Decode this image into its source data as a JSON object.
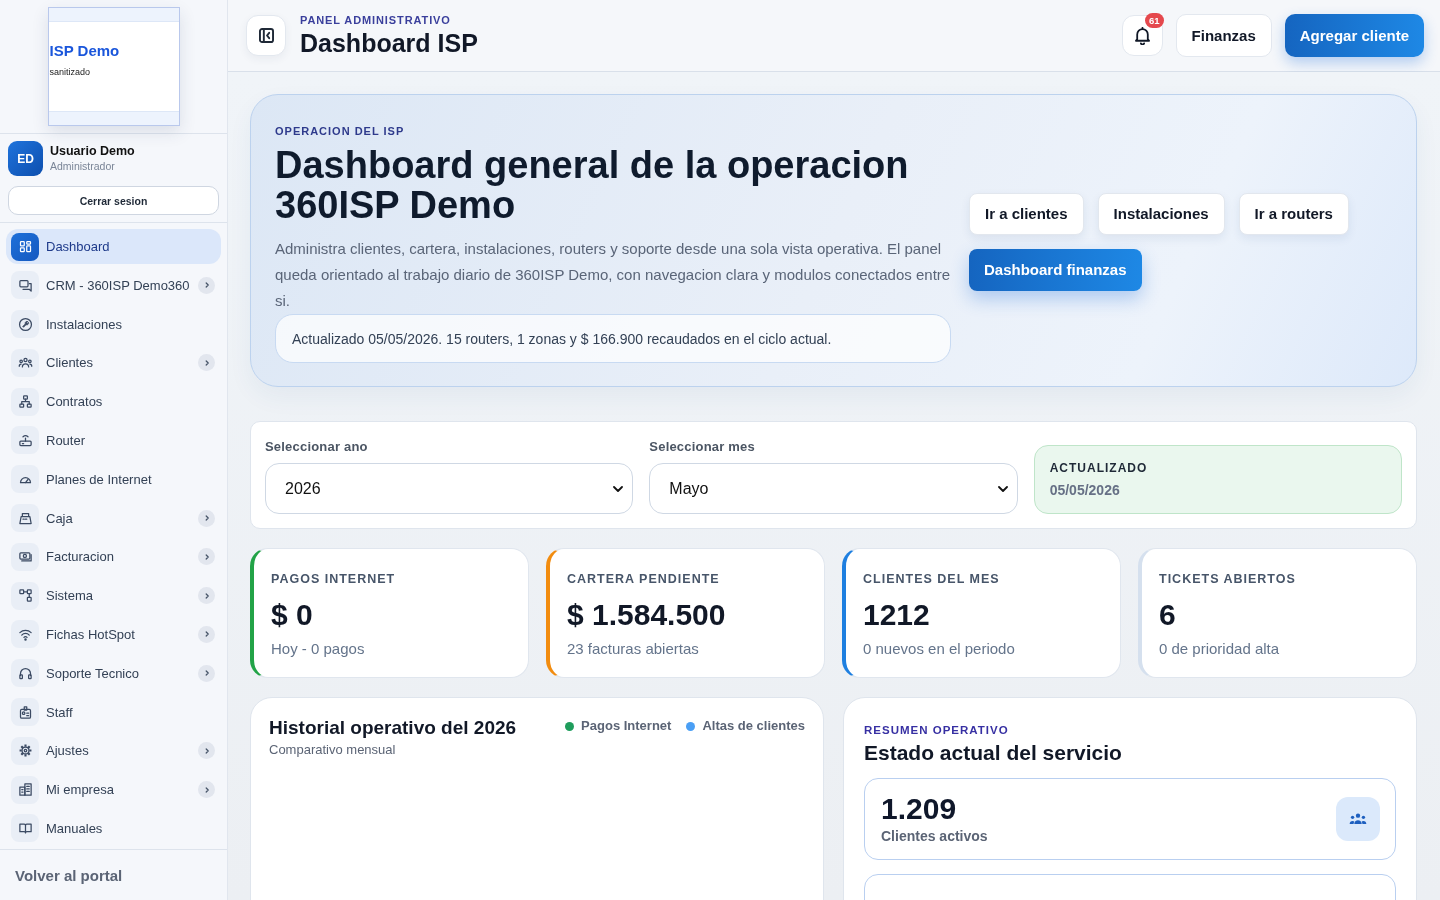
{
  "sidebar": {
    "logo": {
      "title": "ISP Demo",
      "caption": "sanitizado"
    },
    "user": {
      "initials": "ED",
      "name": "Usuario Demo",
      "role": "Administrador",
      "logout": "Cerrar sesion"
    },
    "items": [
      {
        "label": "Dashboard",
        "selected": true,
        "submenu": false
      },
      {
        "label": "CRM - 360ISP Demo360",
        "selected": false,
        "submenu": true
      },
      {
        "label": "Instalaciones",
        "selected": false,
        "submenu": false
      },
      {
        "label": "Clientes",
        "selected": false,
        "submenu": true
      },
      {
        "label": "Contratos",
        "selected": false,
        "submenu": false
      },
      {
        "label": "Router",
        "selected": false,
        "submenu": false
      },
      {
        "label": "Planes de Internet",
        "selected": false,
        "submenu": false
      },
      {
        "label": "Caja",
        "selected": false,
        "submenu": true
      },
      {
        "label": "Facturacion",
        "selected": false,
        "submenu": true
      },
      {
        "label": "Sistema",
        "selected": false,
        "submenu": true
      },
      {
        "label": "Fichas HotSpot",
        "selected": false,
        "submenu": true
      },
      {
        "label": "Soporte Tecnico",
        "selected": false,
        "submenu": true
      },
      {
        "label": "Staff",
        "selected": false,
        "submenu": false
      },
      {
        "label": "Ajustes",
        "selected": false,
        "submenu": true
      },
      {
        "label": "Mi empresa",
        "selected": false,
        "submenu": true
      },
      {
        "label": "Manuales",
        "selected": false,
        "submenu": false
      }
    ],
    "footer_link": "Volver al portal"
  },
  "header": {
    "eyebrow": "PANEL ADMINISTRATIVO",
    "title": "Dashboard ISP",
    "notifications": "61",
    "buttons": [
      {
        "label": "Finanzas",
        "kind": "secondary"
      },
      {
        "label": "Agregar cliente",
        "kind": "primary"
      }
    ]
  },
  "hero": {
    "eyebrow": "OPERACION DEL ISP",
    "title": "Dashboard general de la operacion 360ISP Demo",
    "description": "Administra clientes, cartera, instalaciones, routers y soporte desde una sola vista operativa. El panel queda orientado al trabajo diario de 360ISP Demo, con navegacion clara y modulos conectados entre si.",
    "note": "Actualizado 05/05/2026. 15 routers, 1 zonas y $ 166.900 recaudados en el ciclo actual.",
    "actions": [
      {
        "label": "Ir a clientes",
        "kind": "secondary"
      },
      {
        "label": "Instalaciones",
        "kind": "secondary"
      },
      {
        "label": "Ir a routers",
        "kind": "secondary"
      },
      {
        "label": "Dashboard finanzas",
        "kind": "primary"
      }
    ]
  },
  "filters": {
    "year": {
      "label": "Seleccionar ano",
      "value": "2026"
    },
    "month": {
      "label": "Seleccionar mes",
      "value": "Mayo"
    },
    "updated": {
      "label": "ACTUALIZADO",
      "value": "05/05/2026"
    }
  },
  "stats": [
    {
      "label": "PAGOS INTERNET",
      "value": "$ 0",
      "detail": "Hoy - 0 pagos",
      "color": "#22a347"
    },
    {
      "label": "CARTERA PENDIENTE",
      "value": "$ 1.584.500",
      "detail": "23 facturas abiertas",
      "color": "#f28c0f"
    },
    {
      "label": "CLIENTES DEL MES",
      "value": "1212",
      "detail": "0 nuevos en el periodo",
      "color": "#1e7fe0"
    },
    {
      "label": "TICKETS ABIERTOS",
      "value": "6",
      "detail": "0 de prioridad alta",
      "color": "#d5e0ee"
    }
  ],
  "history": {
    "title": "Historial operativo del 2026",
    "subtitle": "Comparativo mensual",
    "legend": [
      {
        "label": "Pagos Internet",
        "color": "#1f9d5c"
      },
      {
        "label": "Altas de clientes",
        "color": "#4a9ff5"
      }
    ]
  },
  "summary": {
    "eyebrow": "RESUMEN OPERATIVO",
    "title": "Estado actual del servicio",
    "metrics": [
      {
        "value": "1.209",
        "label": "Clientes activos"
      }
    ]
  }
}
